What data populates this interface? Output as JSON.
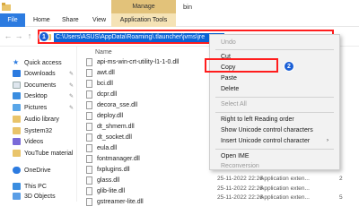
{
  "window": {
    "manage_tab": "Manage",
    "title": "bin"
  },
  "ribbon": {
    "tabs": [
      "File",
      "Home",
      "Share",
      "View",
      "Application Tools"
    ]
  },
  "address_bar": {
    "path": "C:\\Users\\ASUS\\AppData\\Roaming\\.tlauncher\\jvms\\jre",
    "step_badge": "1"
  },
  "sidebar": {
    "items": [
      {
        "label": "Quick access",
        "icon": "star-icon",
        "pinned": false
      },
      {
        "label": "Downloads",
        "icon": "download-icon",
        "pinned": true
      },
      {
        "label": "Documents",
        "icon": "document-icon",
        "pinned": true
      },
      {
        "label": "Desktop",
        "icon": "desktop-icon",
        "pinned": true
      },
      {
        "label": "Pictures",
        "icon": "pictures-icon",
        "pinned": true
      },
      {
        "label": "Audio library",
        "icon": "folder-icon",
        "pinned": false
      },
      {
        "label": "System32",
        "icon": "folder-icon",
        "pinned": false
      },
      {
        "label": "Videos",
        "icon": "videos-icon",
        "pinned": false
      },
      {
        "label": "YouTube material",
        "icon": "folder-icon",
        "pinned": false
      },
      {
        "label": "OneDrive",
        "icon": "cloud-icon",
        "pinned": false
      },
      {
        "label": "This PC",
        "icon": "pc-icon",
        "pinned": false
      },
      {
        "label": "3D Objects",
        "icon": "cube-icon",
        "pinned": false
      }
    ]
  },
  "files": {
    "header": "Name",
    "rows": [
      {
        "name": "api-ms-win-crt-utility-l1-1-0.dll",
        "date": "",
        "type": "",
        "size": ""
      },
      {
        "name": "awt.dll",
        "date": "",
        "type": "",
        "size": ""
      },
      {
        "name": "bci.dll",
        "date": "",
        "type": "",
        "size": ""
      },
      {
        "name": "dcpr.dll",
        "date": "",
        "type": "",
        "size": ""
      },
      {
        "name": "decora_sse.dll",
        "date": "",
        "type": "",
        "size": ""
      },
      {
        "name": "deploy.dll",
        "date": "",
        "type": "",
        "size": ""
      },
      {
        "name": "dt_shmem.dll",
        "date": "",
        "type": "",
        "size": ""
      },
      {
        "name": "dt_socket.dll",
        "date": "",
        "type": "",
        "size": ""
      },
      {
        "name": "eula.dll",
        "date": "",
        "type": "",
        "size": ""
      },
      {
        "name": "fontmanager.dll",
        "date": "",
        "type": "",
        "size": ""
      },
      {
        "name": "fxplugins.dll",
        "date": "",
        "type": "",
        "size": ""
      },
      {
        "name": "glass.dll",
        "date": "25-11-2022 22:26",
        "type": "Application exten...",
        "size": "2"
      },
      {
        "name": "glib-lite.dll",
        "date": "25-11-2022 22:26",
        "type": "Application exten...",
        "size": ""
      },
      {
        "name": "gstreamer-lite.dll",
        "date": "25-11-2022 22:26",
        "type": "Application exten...",
        "size": "5"
      }
    ]
  },
  "context_menu": {
    "items": [
      {
        "label": "Undo",
        "disabled": true
      },
      {
        "label": "Cut",
        "disabled": false
      },
      {
        "label": "Copy",
        "disabled": false
      },
      {
        "label": "Paste",
        "disabled": false
      },
      {
        "label": "Delete",
        "disabled": false
      },
      {
        "label": "Select All",
        "disabled": true
      },
      {
        "label": "Right to left Reading order",
        "disabled": false
      },
      {
        "label": "Show Unicode control characters",
        "disabled": false
      },
      {
        "label": "Insert Unicode control character",
        "disabled": false
      },
      {
        "label": "Open IME",
        "disabled": false
      },
      {
        "label": "Reconversion",
        "disabled": true
      }
    ],
    "copy_step_badge": "2"
  },
  "colors": {
    "accent": "#2c7be0",
    "highlight_box": "#ff1d1d",
    "manage_tab": "#e2c27a",
    "selection": "#0a63d6"
  }
}
